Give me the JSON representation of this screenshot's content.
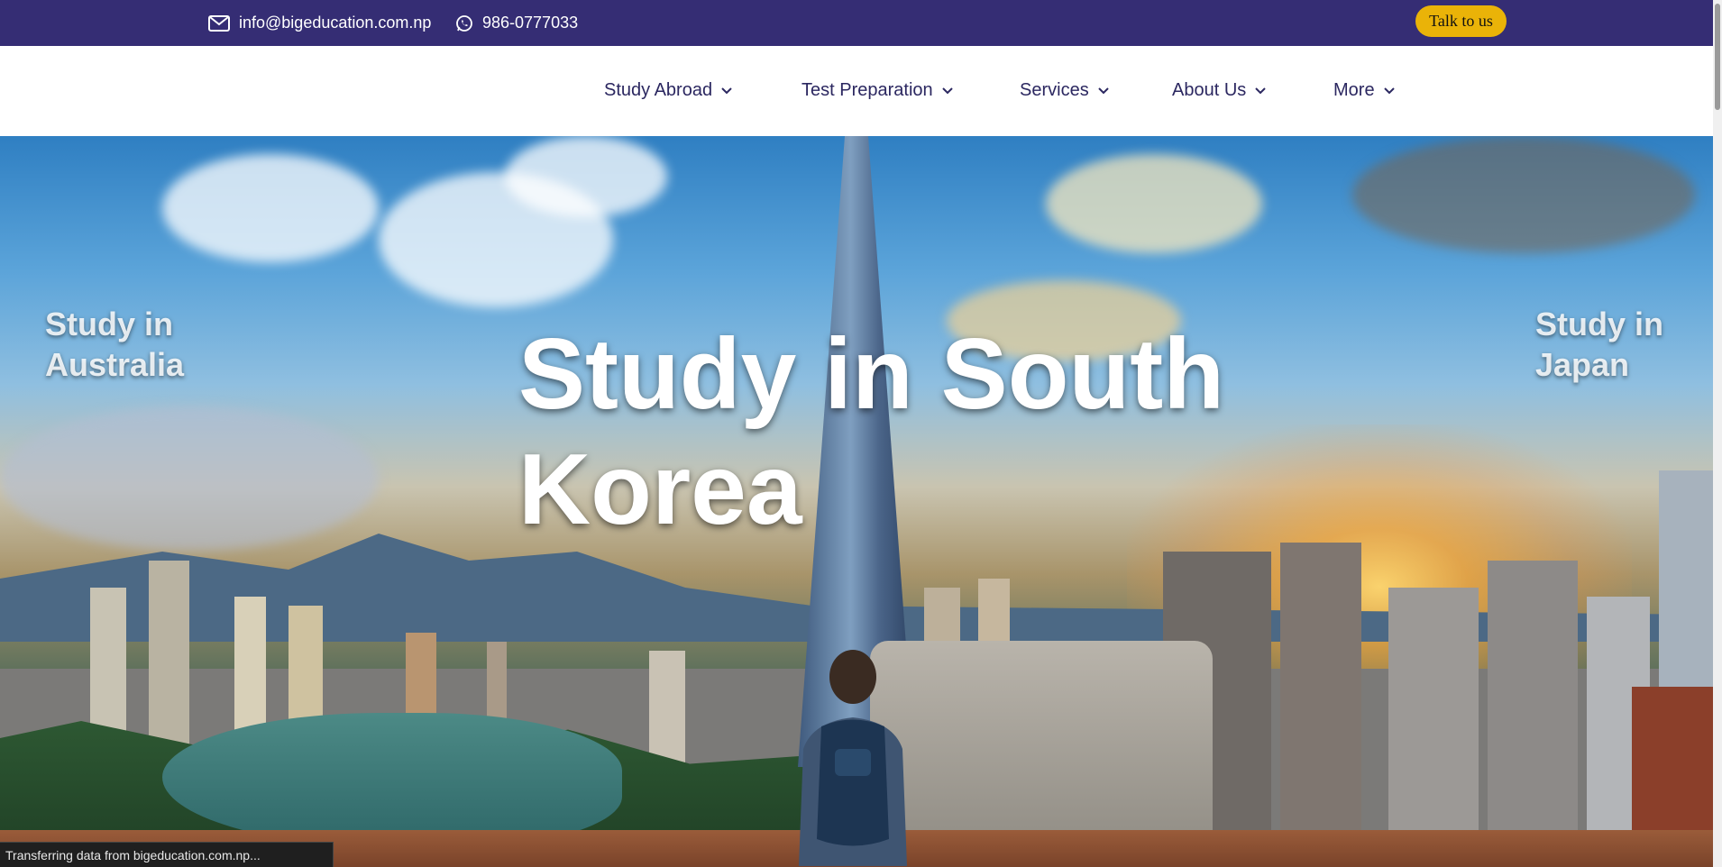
{
  "topbar": {
    "email": "info@bigeducation.com.np",
    "phone": "986-0777033",
    "cta_label": "Talk to us",
    "colors": {
      "bar": "#352d74",
      "cta": "#eab308"
    },
    "icons": {
      "email": "mail-icon",
      "phone": "whatsapp-icon"
    }
  },
  "nav": {
    "items": [
      {
        "label": "Study Abroad"
      },
      {
        "label": "Test Preparation"
      },
      {
        "label": "Services"
      },
      {
        "label": "About Us"
      },
      {
        "label": "More"
      }
    ],
    "color": "#2b2760",
    "icon": "chevron-down-icon"
  },
  "hero": {
    "title": "Study in South Korea",
    "prev_slide": "Study in Australia",
    "next_slide": "Study in Japan"
  },
  "status": {
    "text": "Transferring data from bigeducation.com.np..."
  }
}
